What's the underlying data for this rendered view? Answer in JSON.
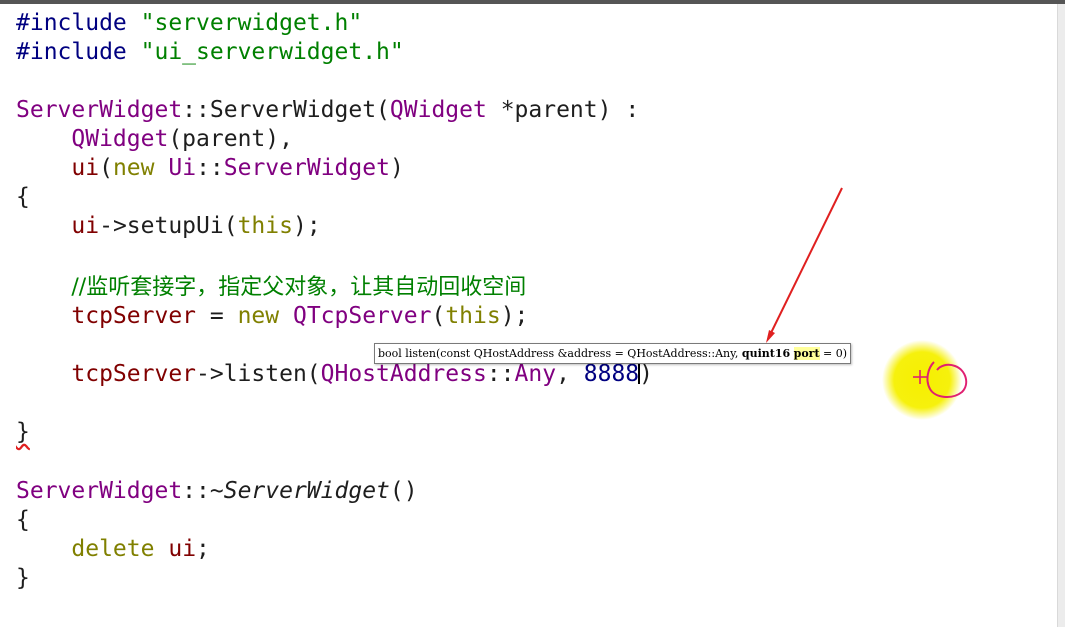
{
  "code": {
    "l1": {
      "a": "#include",
      "b": " ",
      "c": "\"serverwidget.h\""
    },
    "l2": {
      "a": "#include",
      "b": " ",
      "c": "\"ui_serverwidget.h\""
    },
    "l4": {
      "a": "ServerWidget",
      "b": "::",
      "c": "ServerWidget",
      "d": "(",
      "e": "QWidget",
      "f": " *parent) :"
    },
    "l5": {
      "a": "    ",
      "b": "QWidget",
      "c": "(parent),"
    },
    "l6": {
      "a": "    ",
      "b": "ui",
      "c": "(",
      "d": "new",
      "e": " ",
      "f": "Ui",
      "g": "::",
      "h": "ServerWidget",
      "i": ")"
    },
    "l7": {
      "a": "{"
    },
    "l8": {
      "a": "    ",
      "b": "ui",
      "c": "->setupUi(",
      "d": "this",
      "e": ");"
    },
    "l10": {
      "a": "    ",
      "b": "//监听套接字，指定父对象，让其自动回收空间"
    },
    "l11": {
      "a": "    ",
      "b": "tcpServer",
      "c": " = ",
      "d": "new",
      "e": " ",
      "f": "QTcpServer",
      "g": "(",
      "h": "this",
      "i": ");"
    },
    "l13": {
      "a": "    ",
      "b": "tcpServer",
      "c": "->listen(",
      "d": "QHostAddress",
      "e": "::",
      "f": "Any",
      "g": ", ",
      "h": "8888",
      "i": ")"
    },
    "l15": {
      "a": "}"
    },
    "l17": {
      "a": "ServerWidget",
      "b": "::~",
      "c": "ServerWidget",
      "d": "()"
    },
    "l18": {
      "a": "{"
    },
    "l19": {
      "a": "    ",
      "b": "delete",
      "c": " ",
      "d": "ui",
      "e": ";"
    },
    "l20": {
      "a": "}"
    }
  },
  "tooltip": {
    "pre": "bool listen(const QHostAddress &address = QHostAddress::Any, ",
    "type": "quint16",
    "space": " ",
    "param": "port",
    "post": " = 0)"
  },
  "colors": {
    "preprocessor": "#000080",
    "string": "#008000",
    "class": "#800080",
    "keyword": "#808000",
    "comment": "#008000",
    "member": "#800000",
    "annotation_arrow": "#e02020",
    "cursor_highlight": "#f6f000"
  },
  "icons": {
    "mouse_cursor": "crosshair-cursor-icon",
    "annotation": "red-arrow-annotation"
  }
}
